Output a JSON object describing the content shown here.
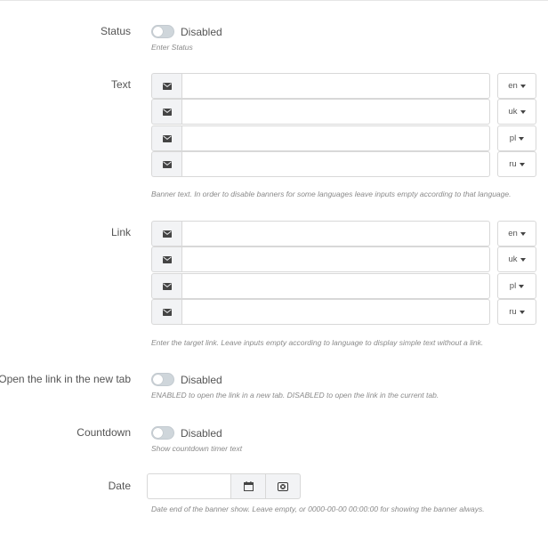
{
  "status": {
    "label": "Status",
    "toggle_text": "Disabled",
    "help": "Enter Status"
  },
  "text": {
    "label": "Text",
    "rows": [
      {
        "lang": "en",
        "value": ""
      },
      {
        "lang": "uk",
        "value": ""
      },
      {
        "lang": "pl",
        "value": ""
      },
      {
        "lang": "ru",
        "value": ""
      }
    ],
    "help": "Banner text. In order to disable banners for some languages leave inputs empty according to that language."
  },
  "link": {
    "label": "Link",
    "rows": [
      {
        "lang": "en",
        "value": ""
      },
      {
        "lang": "uk",
        "value": ""
      },
      {
        "lang": "pl",
        "value": ""
      },
      {
        "lang": "ru",
        "value": ""
      }
    ],
    "help": "Enter the target link. Leave inputs empty according to language to display simple text without a link."
  },
  "new_tab": {
    "label": "Open the link in the new tab",
    "toggle_text": "Disabled",
    "help": "ENABLED to open the link in a new tab. DISABLED to open the link in the current tab."
  },
  "countdown": {
    "label": "Countdown",
    "toggle_text": "Disabled",
    "help": "Show countdown timer text"
  },
  "date": {
    "label": "Date",
    "value": "",
    "help": "Date end of the banner show. Leave empty, or 0000-00-00 00:00:00 for showing the banner always."
  },
  "icons": {
    "addon": "envelope-icon",
    "calendar": "calendar-icon",
    "clear": "clear-icon"
  },
  "colors": {
    "toggle_off": "#cfd6db",
    "addon_bg": "#f2f3f5",
    "border": "#d8d8d8"
  }
}
